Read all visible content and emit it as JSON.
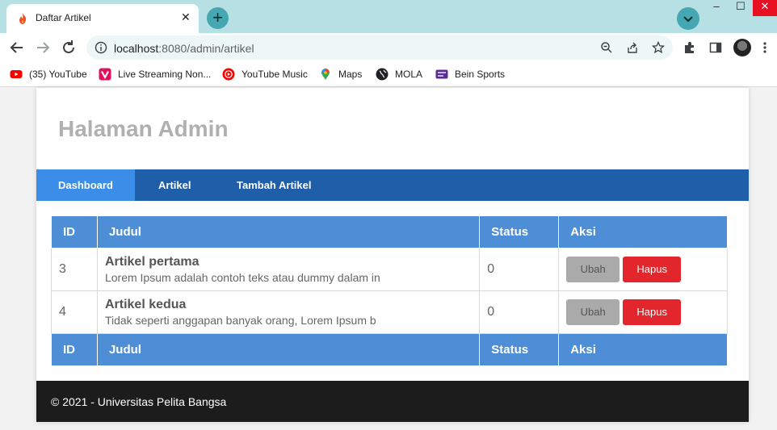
{
  "browser": {
    "tab_title": "Daftar Artikel",
    "tab_close": "✕",
    "new_tab": "+",
    "url_host": "localhost",
    "url_rest": ":8080/admin/artikel",
    "window_controls": {
      "minimize": "–",
      "maximize": "☐",
      "close": "✕"
    },
    "bookmarks": [
      {
        "label": "(35) YouTube",
        "icon": "youtube-icon",
        "color": "#ff0000"
      },
      {
        "label": "Live Streaming Non...",
        "icon": "vidio-icon",
        "color": "#e0115f"
      },
      {
        "label": "YouTube Music",
        "icon": "youtube-music-icon",
        "color": "#ff0000"
      },
      {
        "label": "Maps",
        "icon": "maps-pin-icon",
        "color": "#34a853"
      },
      {
        "label": "MOLA",
        "icon": "mola-globe-icon",
        "color": "#202124"
      },
      {
        "label": "Bein Sports",
        "icon": "bein-sports-icon",
        "color": "#5b2d8e"
      }
    ]
  },
  "page": {
    "header_title": "Halaman Admin",
    "nav": [
      {
        "label": "Dashboard",
        "active": true
      },
      {
        "label": "Artikel",
        "active": false
      },
      {
        "label": "Tambah Artikel",
        "active": false
      }
    ],
    "table": {
      "columns": [
        "ID",
        "Judul",
        "Status",
        "Aksi"
      ],
      "rows": [
        {
          "id": "3",
          "title": "Artikel pertama",
          "desc": "Lorem Ipsum adalah contoh teks atau dummy dalam in",
          "status": "0",
          "edit_label": "Ubah",
          "delete_label": "Hapus"
        },
        {
          "id": "4",
          "title": "Artikel kedua",
          "desc": "Tidak seperti anggapan banyak orang, Lorem Ipsum b",
          "status": "0",
          "edit_label": "Ubah",
          "delete_label": "Hapus"
        }
      ]
    },
    "footer_text": "© 2021 - Universitas Pelita Bangsa"
  },
  "colors": {
    "nav_bar": "#1f5faa",
    "nav_active": "#3b8de8",
    "table_header": "#4d8ed6",
    "delete_button": "#e3262b",
    "edit_button": "#aaaaaa",
    "footer": "#1c1c1c",
    "chrome_accent": "#b7e0e4"
  }
}
